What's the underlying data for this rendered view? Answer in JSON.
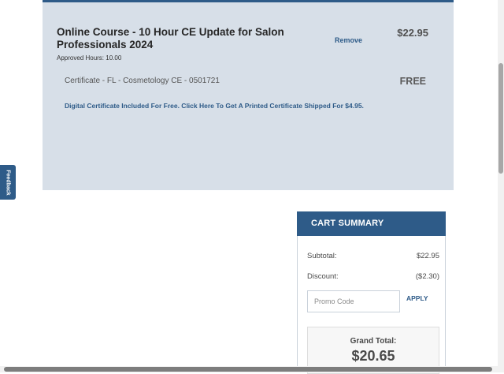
{
  "cart_item": {
    "title": "Online Course - 10 Hour CE Update for Salon Professionals 2024",
    "approved_hours": "Approved Hours: 10.00",
    "remove_label": "Remove",
    "price": "$22.95",
    "certificate": "Certificate - FL - Cosmetology CE - 0501721",
    "certificate_price": "FREE",
    "certificate_note": "Digital Certificate Included For Free. Click Here To Get A Printed Certificate Shipped For $4.95."
  },
  "feedback": {
    "label": "Feedback"
  },
  "summary": {
    "header": "CART SUMMARY",
    "subtotal_label": "Subtotal:",
    "subtotal_value": "$22.95",
    "discount_label": "Discount:",
    "discount_value": "($2.30)",
    "promo_placeholder": "Promo Code",
    "apply_label": "APPLY",
    "grand_total_label": "Grand Total:",
    "grand_total_value": "$20.65"
  },
  "colors": {
    "accent": "#2e5b88",
    "panel_bg": "#d7dfe8"
  }
}
